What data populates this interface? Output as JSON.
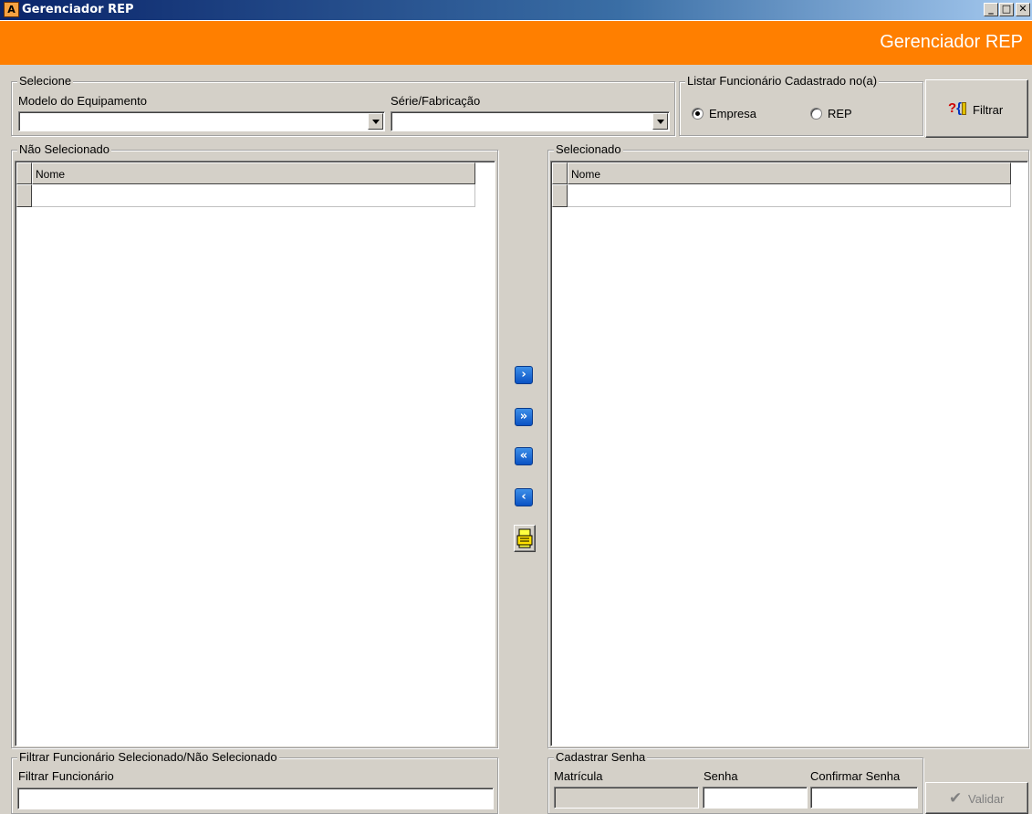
{
  "window": {
    "title": "Gerenciador REP",
    "app_icon": "app-a-icon",
    "controls": [
      "minimize-icon",
      "maximize-icon",
      "close-icon"
    ]
  },
  "banner": {
    "text": "Gerenciador REP",
    "color": "#ff7f00"
  },
  "selecione": {
    "title": "Selecione",
    "modelo_label": "Modelo do Equipamento",
    "modelo_value": "",
    "serie_label": "Série/Fabricação",
    "serie_value": ""
  },
  "listar": {
    "title": "Listar Funcionário Cadastrado no(a)",
    "options": [
      {
        "label": "Empresa",
        "selected": true
      },
      {
        "label": "REP",
        "selected": false
      }
    ]
  },
  "filtrar_button": {
    "label": "Filtrar",
    "icon": "filter-query-icon"
  },
  "nao_selecionado": {
    "title": "Não Selecionado",
    "column": "Nome",
    "rows": [
      ""
    ]
  },
  "selecionado": {
    "title": "Selecionado",
    "column": "Nome",
    "rows": [
      ""
    ]
  },
  "transfer_buttons": [
    {
      "name": "move-right-button",
      "icon": "chevron-right-icon"
    },
    {
      "name": "move-all-right-button",
      "icon": "double-chevron-right-icon"
    },
    {
      "name": "move-all-left-button",
      "icon": "double-chevron-left-icon"
    },
    {
      "name": "move-left-button",
      "icon": "chevron-left-icon"
    },
    {
      "name": "print-button",
      "icon": "printer-icon"
    }
  ],
  "filtrar_funcionario": {
    "title": "Filtrar Funcionário Selecionado/Não Selecionado",
    "label": "Filtrar Funcionário",
    "value": ""
  },
  "cadastrar_senha": {
    "title": "Cadastrar Senha",
    "matricula_label": "Matrícula",
    "senha_label": "Senha",
    "confirmar_label": "Confirmar Senha",
    "validar_label": "Validar",
    "validar_icon": "checkmark-icon"
  }
}
